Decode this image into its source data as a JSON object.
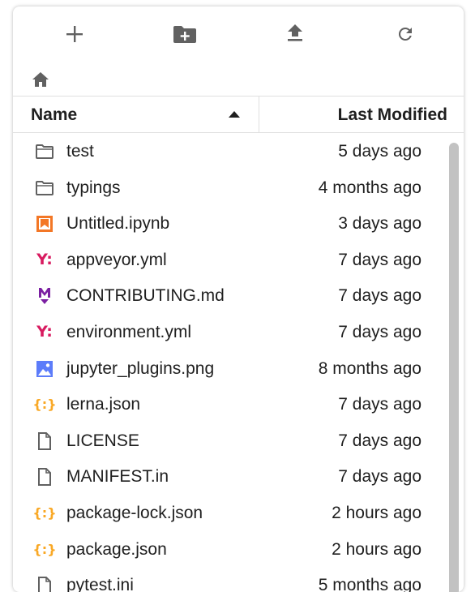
{
  "toolbar": {
    "buttons": [
      {
        "name": "new-launcher",
        "icon": "plus-icon"
      },
      {
        "name": "new-folder",
        "icon": "new-folder-icon"
      },
      {
        "name": "upload",
        "icon": "upload-icon"
      },
      {
        "name": "refresh",
        "icon": "refresh-icon"
      }
    ]
  },
  "breadcrumbs": {
    "home_icon": "home-icon"
  },
  "header": {
    "name_label": "Name",
    "modified_label": "Last Modified",
    "sort": "ascending"
  },
  "files": [
    {
      "name": "test",
      "modified": "5 days ago",
      "icon": "folder-icon"
    },
    {
      "name": "typings",
      "modified": "4 months ago",
      "icon": "folder-icon"
    },
    {
      "name": "Untitled.ipynb",
      "modified": "3 days ago",
      "icon": "notebook-icon"
    },
    {
      "name": "appveyor.yml",
      "modified": "7 days ago",
      "icon": "yaml-icon"
    },
    {
      "name": "CONTRIBUTING.md",
      "modified": "7 days ago",
      "icon": "markdown-icon"
    },
    {
      "name": "environment.yml",
      "modified": "7 days ago",
      "icon": "yaml-icon"
    },
    {
      "name": "jupyter_plugins.png",
      "modified": "8 months ago",
      "icon": "image-icon"
    },
    {
      "name": "lerna.json",
      "modified": "7 days ago",
      "icon": "json-icon"
    },
    {
      "name": "LICENSE",
      "modified": "7 days ago",
      "icon": "file-icon"
    },
    {
      "name": "MANIFEST.in",
      "modified": "7 days ago",
      "icon": "file-icon"
    },
    {
      "name": "package-lock.json",
      "modified": "2 hours ago",
      "icon": "json-icon"
    },
    {
      "name": "package.json",
      "modified": "2 hours ago",
      "icon": "json-icon"
    },
    {
      "name": "pytest.ini",
      "modified": "5 months ago",
      "icon": "file-icon"
    }
  ],
  "colors": {
    "icon_gray": "#616161",
    "notebook_orange": "#f37726",
    "yaml_pink": "#d81b60",
    "markdown_purple": "#7b1fa2",
    "image_blue": "#5c7cfa",
    "json_yellow": "#f9a825"
  }
}
